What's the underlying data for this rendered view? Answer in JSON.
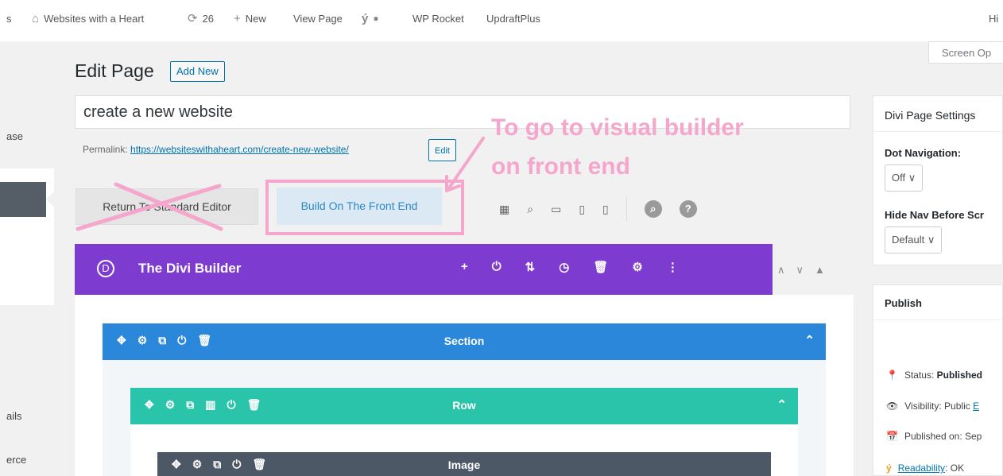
{
  "admin_bar": {
    "partial_left": "s",
    "site_name": "Websites with a Heart",
    "updates_count": "26",
    "new_label": "New",
    "view_page": "View Page",
    "wp_rocket": "WP Rocket",
    "updraft": "UpdraftPlus",
    "howdy_partial": "Hi"
  },
  "sidebar": {
    "partial_1": "ase",
    "partial_2": "ails",
    "partial_3": "erce"
  },
  "editor": {
    "heading": "Edit Page",
    "add_new": "Add New",
    "title_value": "create a new website",
    "permalink_label": "Permalink:",
    "permalink_url": "https://websiteswithaheart.com/create-new-website/",
    "edit_label": "Edit",
    "return_label": "Return To Standard Editor",
    "front_end_label": "Build On The Front End"
  },
  "annotation": {
    "line1": "To go to visual builder",
    "line2": "on front end"
  },
  "divi": {
    "logo_letter": "D",
    "title": "The Divi Builder",
    "section_label": "Section",
    "row_label": "Row",
    "module_label": "Image"
  },
  "right": {
    "screen_options": "Screen Op",
    "settings_title": "Divi Page Settings",
    "dot_nav_label": "Dot Navigation:",
    "dot_nav_value": "Off",
    "hide_nav_label": "Hide Nav Before Scr",
    "hide_nav_value": "Default",
    "publish_title": "Publish",
    "status_label": "Status:",
    "status_value": "Published",
    "visibility_label": "Visibility:",
    "visibility_value": "Public",
    "visibility_edit": "E",
    "published_on": "Published on: Sep",
    "readability_link": "Readability",
    "readability_value": ": OK"
  },
  "colors": {
    "divi_purple": "#7e3bd0",
    "section_blue": "#2b87da",
    "row_green": "#29c4a9",
    "module_gray": "#4c5866",
    "annotation_pink": "#f5a6cc",
    "wp_link": "#0073aa"
  },
  "icons": [
    "home-icon",
    "updates-icon",
    "plus-icon",
    "yoast-icon",
    "status-dot-icon",
    "wireframe-icon",
    "zoom-icon",
    "desktop-icon",
    "tablet-icon",
    "phone-icon",
    "search-icon",
    "help-icon",
    "move-icon",
    "gear-icon",
    "clone-icon",
    "power-icon",
    "trash-icon",
    "columns-icon",
    "sort-icon",
    "history-icon",
    "menu-dots-icon",
    "chevron-up-icon",
    "chevron-down-icon",
    "pin-icon",
    "eye-icon",
    "calendar-icon"
  ]
}
